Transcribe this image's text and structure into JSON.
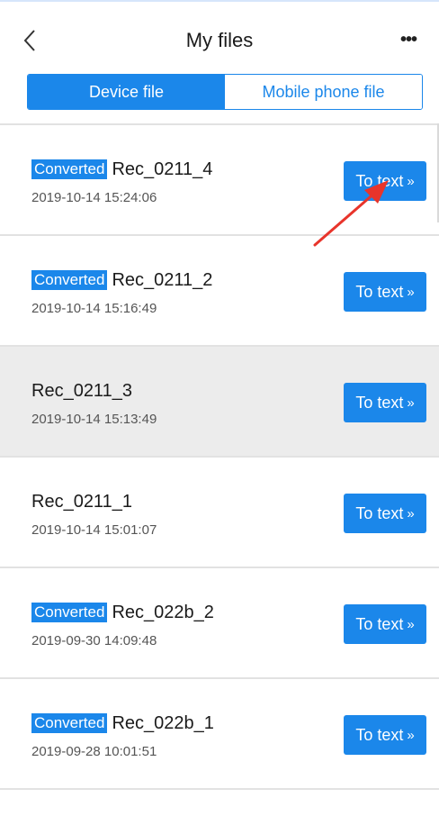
{
  "header": {
    "title": "My files",
    "back_icon": "chevron-left-icon",
    "more_label": "•••"
  },
  "tabs": [
    {
      "label": "Device file",
      "active": true
    },
    {
      "label": "Mobile phone file",
      "active": false
    }
  ],
  "files": [
    {
      "converted": true,
      "badge": "Converted",
      "name": "Rec_0211_4",
      "time": "2019-10-14 15:24:06",
      "action": "To text",
      "action_icon": "»"
    },
    {
      "converted": true,
      "badge": "Converted",
      "name": "Rec_0211_2",
      "time": "2019-10-14 15:16:49",
      "action": "To text",
      "action_icon": "»"
    },
    {
      "converted": false,
      "badge": "",
      "name": "Rec_0211_3",
      "time": "2019-10-14 15:13:49",
      "action": "To text",
      "action_icon": "»",
      "selected": true
    },
    {
      "converted": false,
      "badge": "",
      "name": "Rec_0211_1",
      "time": "2019-10-14 15:01:07",
      "action": "To text",
      "action_icon": "»"
    },
    {
      "converted": true,
      "badge": "Converted",
      "name": "Rec_022b_2",
      "time": "2019-09-30 14:09:48",
      "action": "To text",
      "action_icon": "»"
    },
    {
      "converted": true,
      "badge": "Converted",
      "name": "Rec_022b_1",
      "time": "2019-09-28 10:01:51",
      "action": "To text",
      "action_icon": "»"
    }
  ],
  "colors": {
    "accent": "#1b87ea",
    "selected_row": "#ececec",
    "annotation_arrow": "#e8342b"
  }
}
